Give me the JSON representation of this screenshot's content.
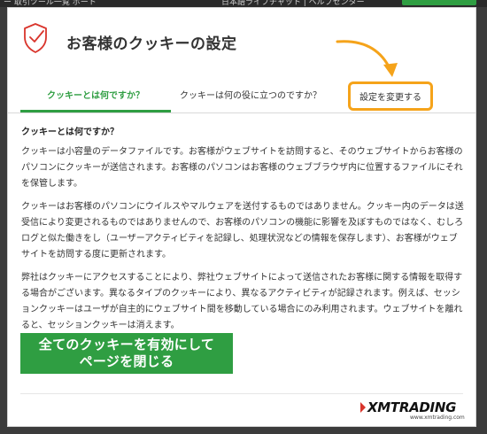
{
  "background": {
    "top_text_left": "ー  取引ツール一覧       ポート",
    "top_text_right": "日本語ライブチャット  |  ヘルプセンター"
  },
  "modal": {
    "title": "お客様のクッキーの設定",
    "shield_icon": "shield-check-icon",
    "accent_color": "#2f9e42",
    "highlight_color": "#f5a31a"
  },
  "tabs": [
    {
      "label": "クッキーとは何ですか？",
      "active": true
    },
    {
      "label": "クッキーは何の役に立つのですか？",
      "active": false
    },
    {
      "label": "設定を変更する",
      "active": false
    }
  ],
  "content": {
    "heading": "クッキーとは何ですか？",
    "paragraphs": [
      "クッキーは小容量のデータファイルです。お客様がウェブサイトを訪問すると、そのウェブサイトからお客様のパソコンにクッキーが送信されます。お客様のパソコンはお客様のウェブブラウザ内に位置するファイルにそれを保管します。",
      "クッキーはお客様のパソコンにウイルスやマルウェアを送付するものではありません。クッキー内のデータは送受信により変更されるものではありませんので、お客様のパソコンの機能に影響を及ぼすものではなく、むしろログと似た働きをし（ユーザーアクティビティを記録し、処理状況などの情報を保存します）、お客様がウェブサイトを訪問する度に更新されます。",
      "弊社はクッキーにアクセスすることにより、弊社ウェブサイトによって送信されたお客様に関する情報を取得する場合がございます。異なるタイプのクッキーにより、異なるアクティビティが記録されます。例えば、セッションクッキーはユーザが自主的にウェブサイト間を移動している場合にのみ利用されます。ウェブサイトを離れると、セッションクッキーは消えます。"
    ]
  },
  "cta": {
    "label": "全てのクッキーを有効にしてページを閉じる"
  },
  "footer": {
    "logo_text": "XMTRADING",
    "logo_url": "www.xmtrading.com"
  }
}
